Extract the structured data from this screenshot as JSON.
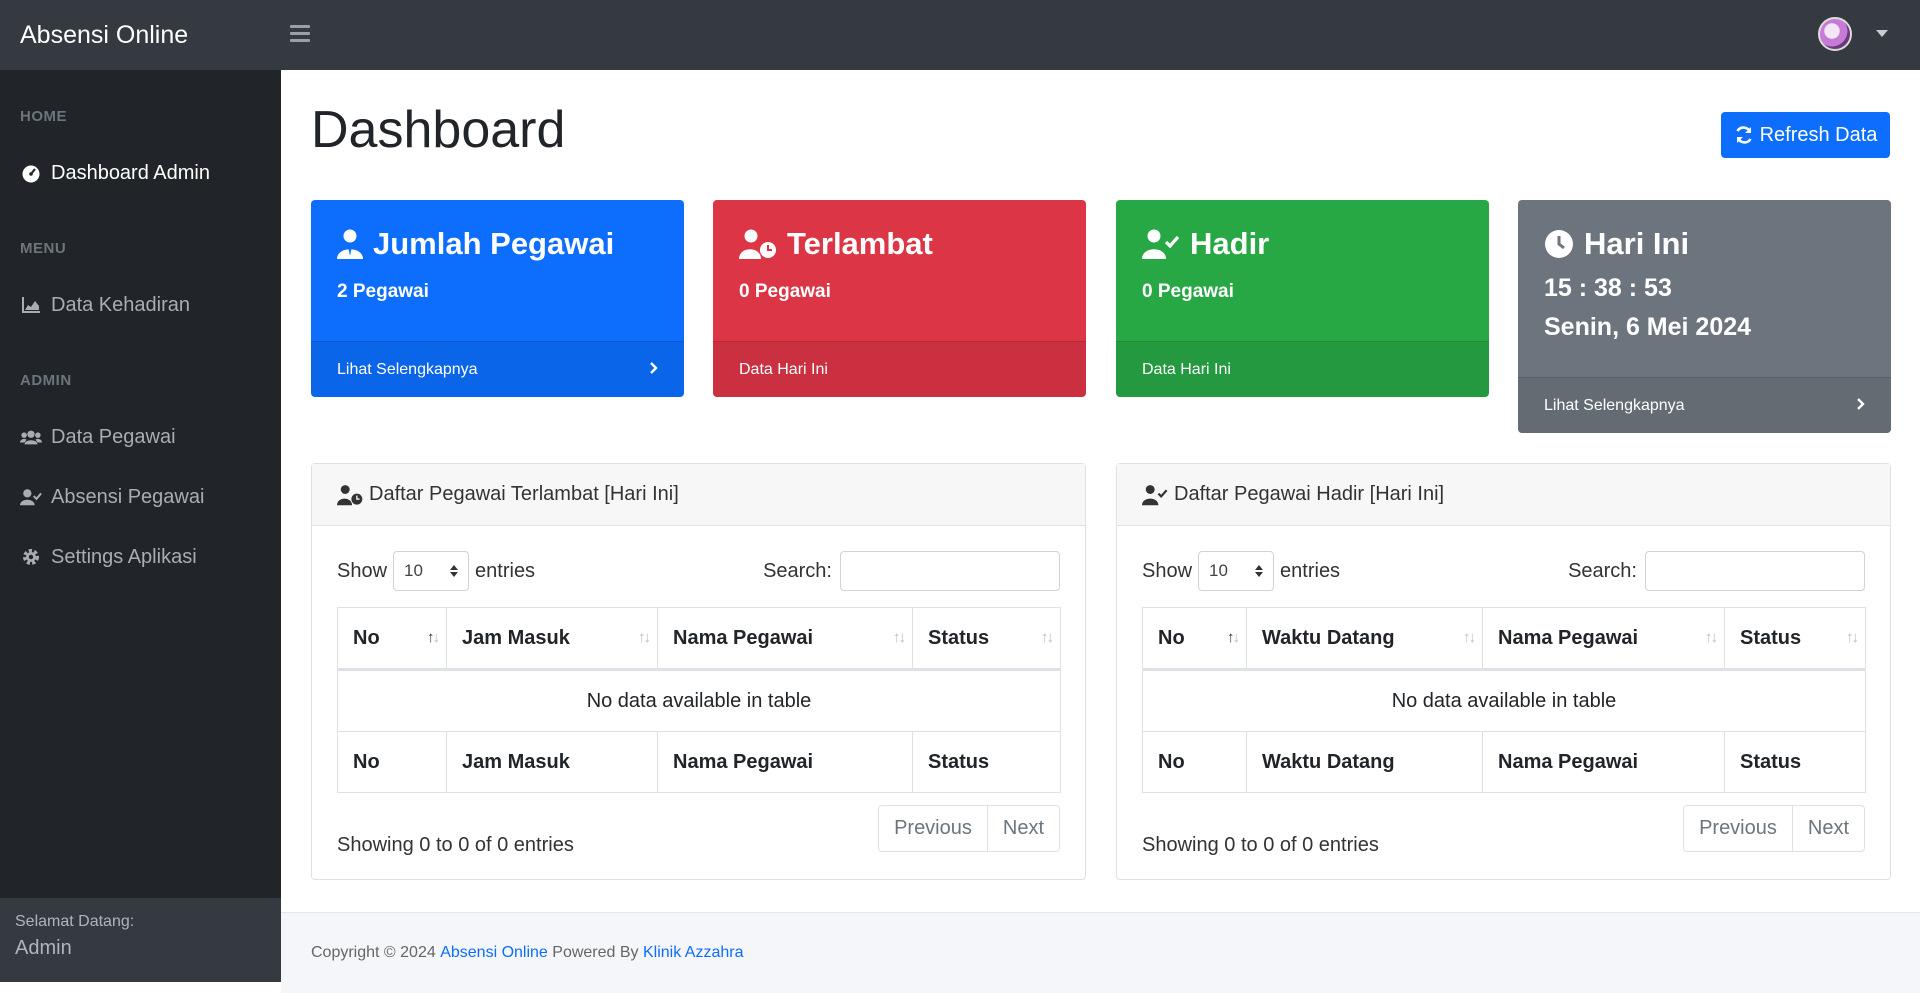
{
  "app": {
    "title": "Absensi Online"
  },
  "sidebar": {
    "headings": [
      "HOME",
      "MENU",
      "ADMIN"
    ],
    "items": [
      {
        "label": "Dashboard Admin",
        "icon": "gauge-icon"
      },
      {
        "label": "Data Kehadiran",
        "icon": "area-chart-icon"
      },
      {
        "label": "Data Pegawai",
        "icon": "users-icon"
      },
      {
        "label": "Absensi Pegawai",
        "icon": "user-check-icon"
      },
      {
        "label": "Settings Aplikasi",
        "icon": "gear-icon"
      }
    ],
    "footer": {
      "greeting": "Selamat Datang:",
      "user": "Admin"
    }
  },
  "main": {
    "title": "Dashboard",
    "refresh_label": "Refresh Data",
    "cards": [
      {
        "title": "Jumlah Pegawai",
        "value": "2 Pegawai",
        "footer": "Lihat Selengkapnya",
        "color": "#0d6efd"
      },
      {
        "title": "Terlambat",
        "value": "0 Pegawai",
        "footer": "Data Hari Ini",
        "color": "#dc3545"
      },
      {
        "title": "Hadir",
        "value": "0 Pegawai",
        "footer": "Data Hari Ini",
        "color": "#28a745"
      },
      {
        "title": "Hari Ini",
        "time": "15 : 38 : 53",
        "date": "Senin, 6 Mei 2024",
        "footer": "Lihat Selengkapnya",
        "color": "#6c757d"
      }
    ],
    "panels": [
      {
        "title": "Daftar Pegawai Terlambat [Hari Ini]",
        "show_label": "Show",
        "entries_value": "10",
        "entries_label": "entries",
        "search_label": "Search:",
        "columns": [
          "No",
          "Jam Masuk",
          "Nama Pegawai",
          "Status"
        ],
        "empty": "No data available in table",
        "info": "Showing 0 to 0 of 0 entries",
        "prev": "Previous",
        "next": "Next"
      },
      {
        "title": "Daftar Pegawai Hadir [Hari Ini]",
        "show_label": "Show",
        "entries_value": "10",
        "entries_label": "entries",
        "search_label": "Search:",
        "columns": [
          "No",
          "Waktu Datang",
          "Nama Pegawai",
          "Status"
        ],
        "empty": "No data available in table",
        "info": "Showing 0 to 0 of 0 entries",
        "prev": "Previous",
        "next": "Next"
      }
    ]
  },
  "footer": {
    "copyright": "Copyright © 2024",
    "app_link": "Absensi Online",
    "powered": "Powered By",
    "org_link": "Klinik Azzahra"
  }
}
